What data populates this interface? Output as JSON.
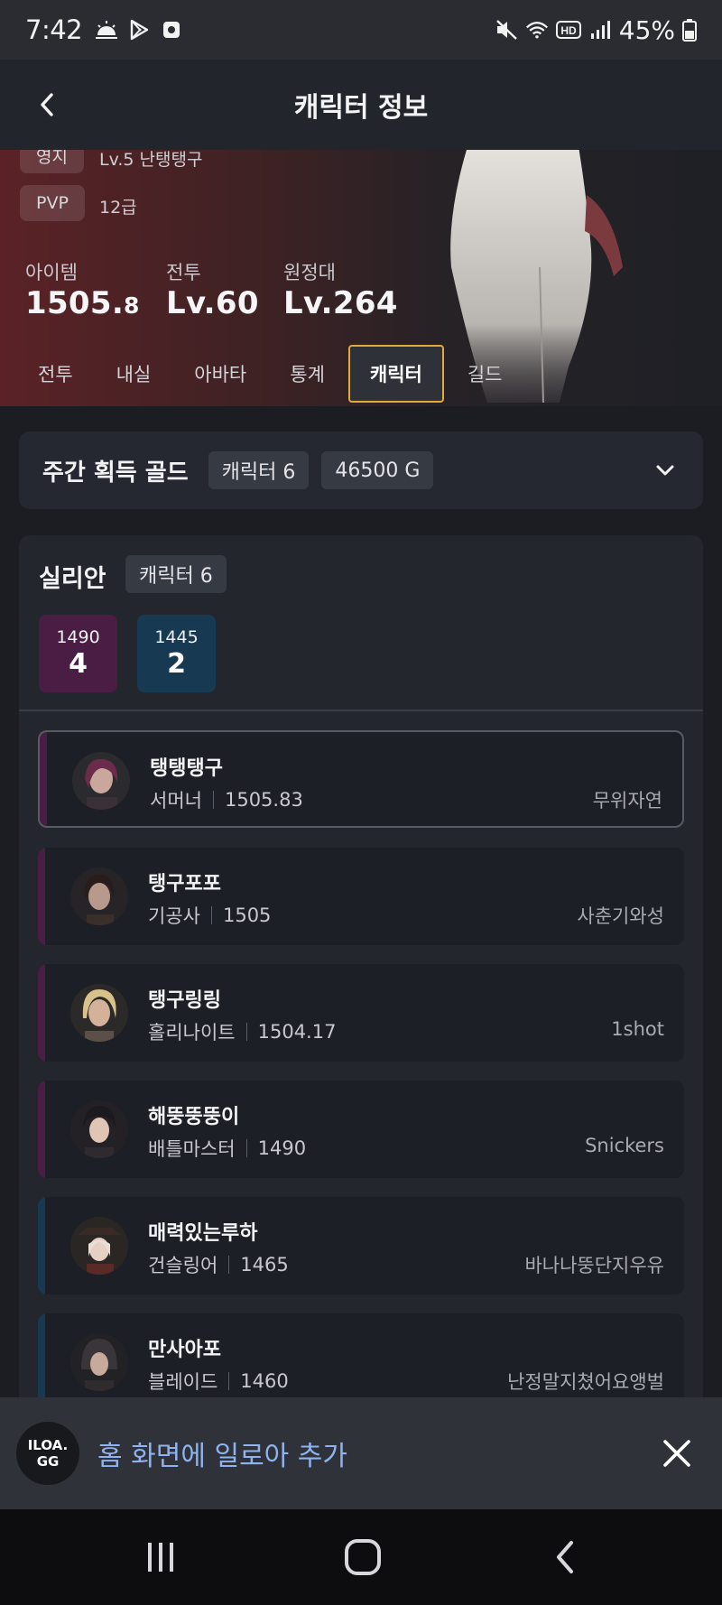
{
  "status_bar": {
    "time": "7:42",
    "battery": "45%",
    "icons_left": [
      "weather-icon",
      "play-store-icon",
      "app-notification-icon"
    ],
    "icons_right": [
      "mute-icon",
      "wifi-icon",
      "hd-icon",
      "signal-icon",
      "battery-icon"
    ]
  },
  "header": {
    "title": "캐릭터 정보"
  },
  "hero": {
    "rows": [
      {
        "label": "영지",
        "value": "Lv.5 난탱탱구"
      },
      {
        "label": "PVP",
        "value": "12급"
      }
    ],
    "stats": [
      {
        "label": "아이템",
        "value_main": "1505.",
        "value_decimal": "8"
      },
      {
        "label": "전투",
        "value_main": "Lv.60",
        "value_decimal": ""
      },
      {
        "label": "원정대",
        "value_main": "Lv.264",
        "value_decimal": ""
      }
    ],
    "tabs": [
      "전투",
      "내실",
      "아바타",
      "통계",
      "캐릭터",
      "길드"
    ],
    "active_tab": "캐릭터"
  },
  "weekly_gold": {
    "title": "주간 획득 골드",
    "character_badge": "캐릭터 6",
    "gold_badge": "46500 G"
  },
  "server": {
    "name": "실리안",
    "character_badge": "캐릭터 6",
    "tiers": [
      {
        "level": "1490",
        "count": "4",
        "color": "#4a1e44"
      },
      {
        "level": "1445",
        "count": "2",
        "color": "#173a52"
      }
    ]
  },
  "characters": [
    {
      "name": "탱탱탱구",
      "class": "서머너",
      "item_level": "1505.83",
      "guild": "무위자연",
      "tier_color": "#4a1e44"
    },
    {
      "name": "탱구포포",
      "class": "기공사",
      "item_level": "1505",
      "guild": "사춘기와성",
      "tier_color": "#4a1e44"
    },
    {
      "name": "탱구링링",
      "class": "홀리나이트",
      "item_level": "1504.17",
      "guild": "1shot",
      "tier_color": "#4a1e44"
    },
    {
      "name": "해뚱뚱뚱이",
      "class": "배틀마스터",
      "item_level": "1490",
      "guild": "Snickers",
      "tier_color": "#4a1e44"
    },
    {
      "name": "매력있는루하",
      "class": "건슬링어",
      "item_level": "1465",
      "guild": "바나나뚱단지우유",
      "tier_color": "#173a52"
    },
    {
      "name": "만사아포",
      "class": "블레이드",
      "item_level": "1460",
      "guild": "난정말지쳤어요앵벌",
      "tier_color": "#173a52"
    }
  ],
  "install_banner": {
    "logo_line1": "ILOA.",
    "logo_line2": "GG",
    "text": "홈 화면에 일로아 추가"
  },
  "colors": {
    "accent_tab_border": "#e2a93b",
    "banner_text": "#8fb3f0"
  }
}
